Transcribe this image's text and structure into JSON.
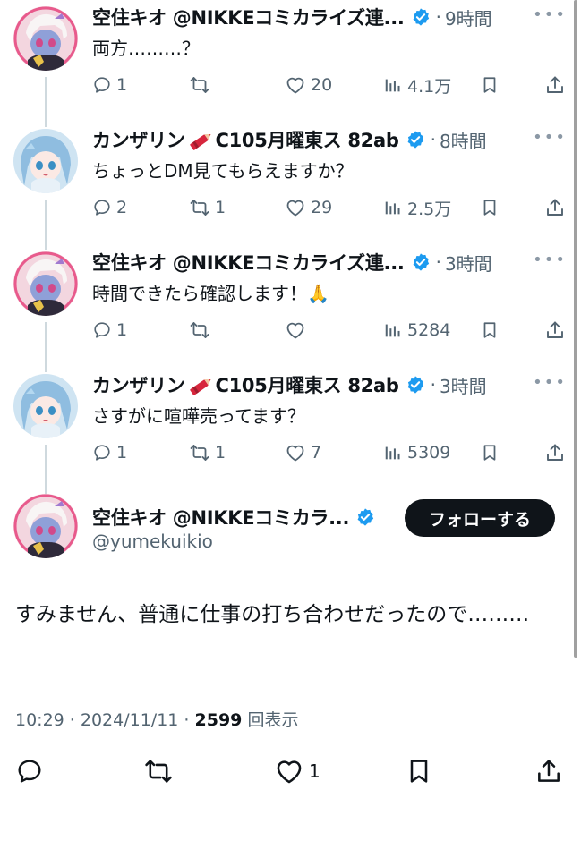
{
  "tweets": [
    {
      "name": "空住キオ @NIKKEコミカライズ連...",
      "time": "9時間",
      "text": "両方………？",
      "replies": "1",
      "retweets": "",
      "likes": "20",
      "views": "4.1万",
      "avatar": "kio"
    },
    {
      "name_pre": "カンザリン",
      "name_post": "C105月曜東ス 82ab",
      "time": "8時間",
      "text": "ちょっとDM見てもらえますか？",
      "replies": "2",
      "retweets": "1",
      "likes": "29",
      "views": "2.5万",
      "avatar": "kanzarin"
    },
    {
      "name": "空住キオ @NIKKEコミカライズ連...",
      "time": "3時間",
      "text": "時間できたら確認します！🙏",
      "replies": "1",
      "retweets": "",
      "likes": "",
      "views": "5284",
      "avatar": "kio"
    },
    {
      "name_pre": "カンザリン",
      "name_post": "C105月曜東ス 82ab",
      "time": "3時間",
      "text": "さすがに喧嘩売ってます？",
      "replies": "1",
      "retweets": "1",
      "likes": "7",
      "views": "5309",
      "avatar": "kanzarin"
    }
  ],
  "common": {
    "dot": "·",
    "more": "•••"
  },
  "main_tweet": {
    "name": "空住キオ @NIKKEコミカラ...",
    "handle": "@yumekuikio",
    "follow_label": "フォローする",
    "text": "すみません、普通に仕事の打ち合わせだったので………",
    "timestamp": "10:29 · 2024/11/11 · ",
    "views_count": "2599",
    "views_label": " 回表示",
    "likes": "1"
  },
  "colors": {
    "text": "#0f1419",
    "secondary": "#536471",
    "verified": "#1d9bf0",
    "thread_line": "#cfd9de",
    "follow_bg": "#0f1419"
  },
  "icons": [
    "reply-icon",
    "retweet-icon",
    "like-icon",
    "views-icon",
    "bookmark-icon",
    "share-icon",
    "verified-badge-icon",
    "more-icon",
    "crayon-emoji"
  ]
}
